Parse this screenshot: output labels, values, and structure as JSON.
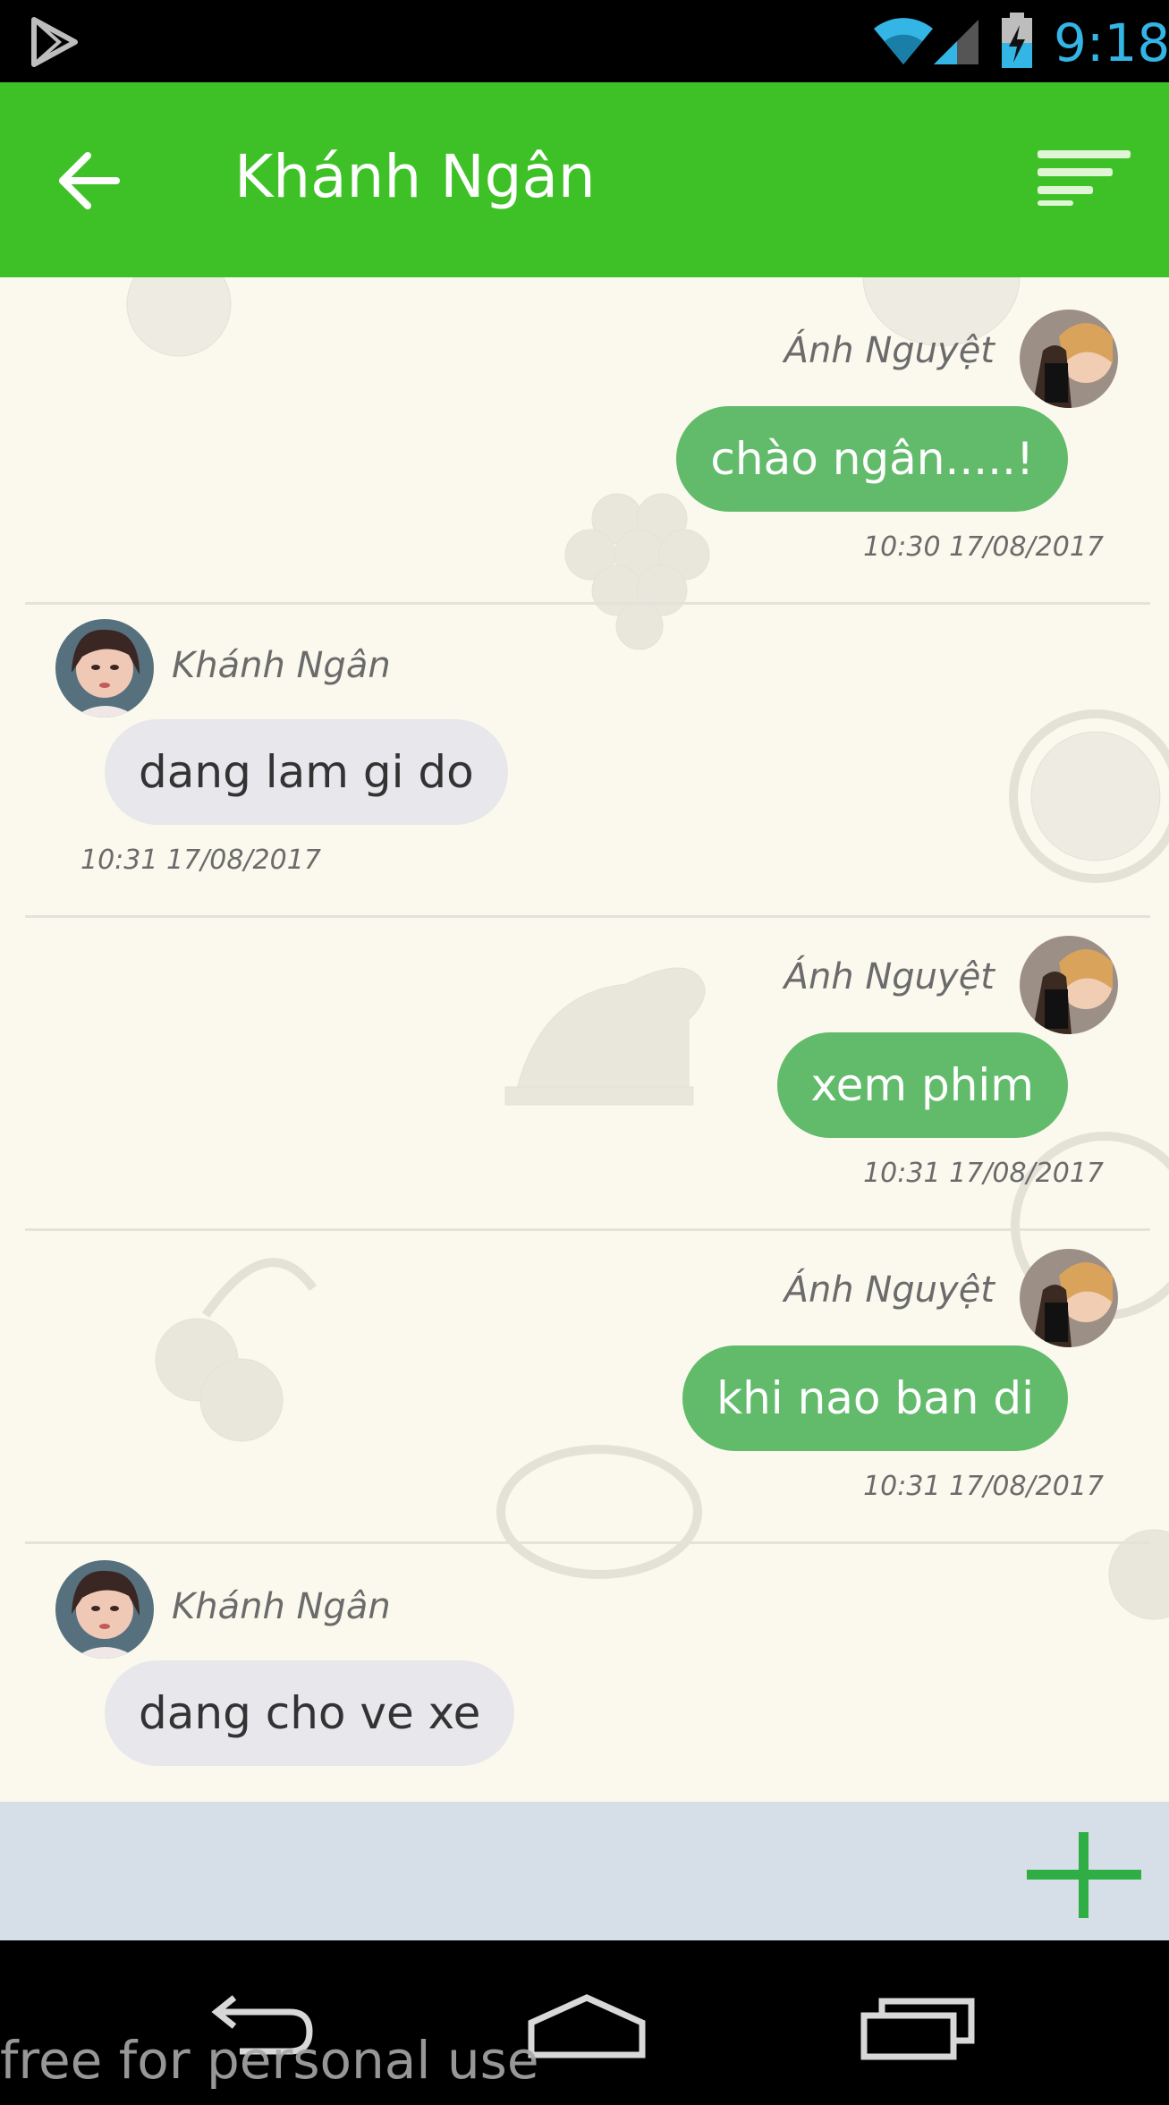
{
  "status_bar": {
    "time": "9:18",
    "icons": [
      "play-store-icon",
      "wifi-icon",
      "signal-icon",
      "battery-charging-icon"
    ],
    "clock_color": "#33b5e5"
  },
  "app_bar": {
    "title": "Khánh Ngân",
    "back_icon": "arrow-left-icon",
    "menu_icon": "sort-menu-icon",
    "color": "#3ec126"
  },
  "messages": [
    {
      "direction": "outgoing",
      "sender": "Ánh Nguyệt",
      "text": "chào ngân.....!",
      "time": "10:30 17/08/2017"
    },
    {
      "direction": "incoming",
      "sender": "Khánh Ngân",
      "text": "dang lam gi do",
      "time": "10:31 17/08/2017"
    },
    {
      "direction": "outgoing",
      "sender": "Ánh Nguyệt",
      "text": "xem phim",
      "time": "10:31 17/08/2017"
    },
    {
      "direction": "outgoing",
      "sender": "Ánh Nguyệt",
      "text": "khi nao ban di",
      "time": "10:31 17/08/2017"
    },
    {
      "direction": "incoming",
      "sender": "Khánh Ngân",
      "text": "dang cho ve xe",
      "time": ""
    }
  ],
  "colors": {
    "outgoing_bubble": "#62bb6b",
    "incoming_bubble": "#e8e7ec",
    "chat_background": "#fbf9ee",
    "input_bar": "#d6dee8",
    "add_button": "#2eae45"
  },
  "input_bar": {
    "add_icon": "plus-icon"
  },
  "nav_bar": {
    "icons": [
      "back-nav-icon",
      "home-nav-icon",
      "recents-nav-icon"
    ]
  },
  "watermark": "free for personal use"
}
